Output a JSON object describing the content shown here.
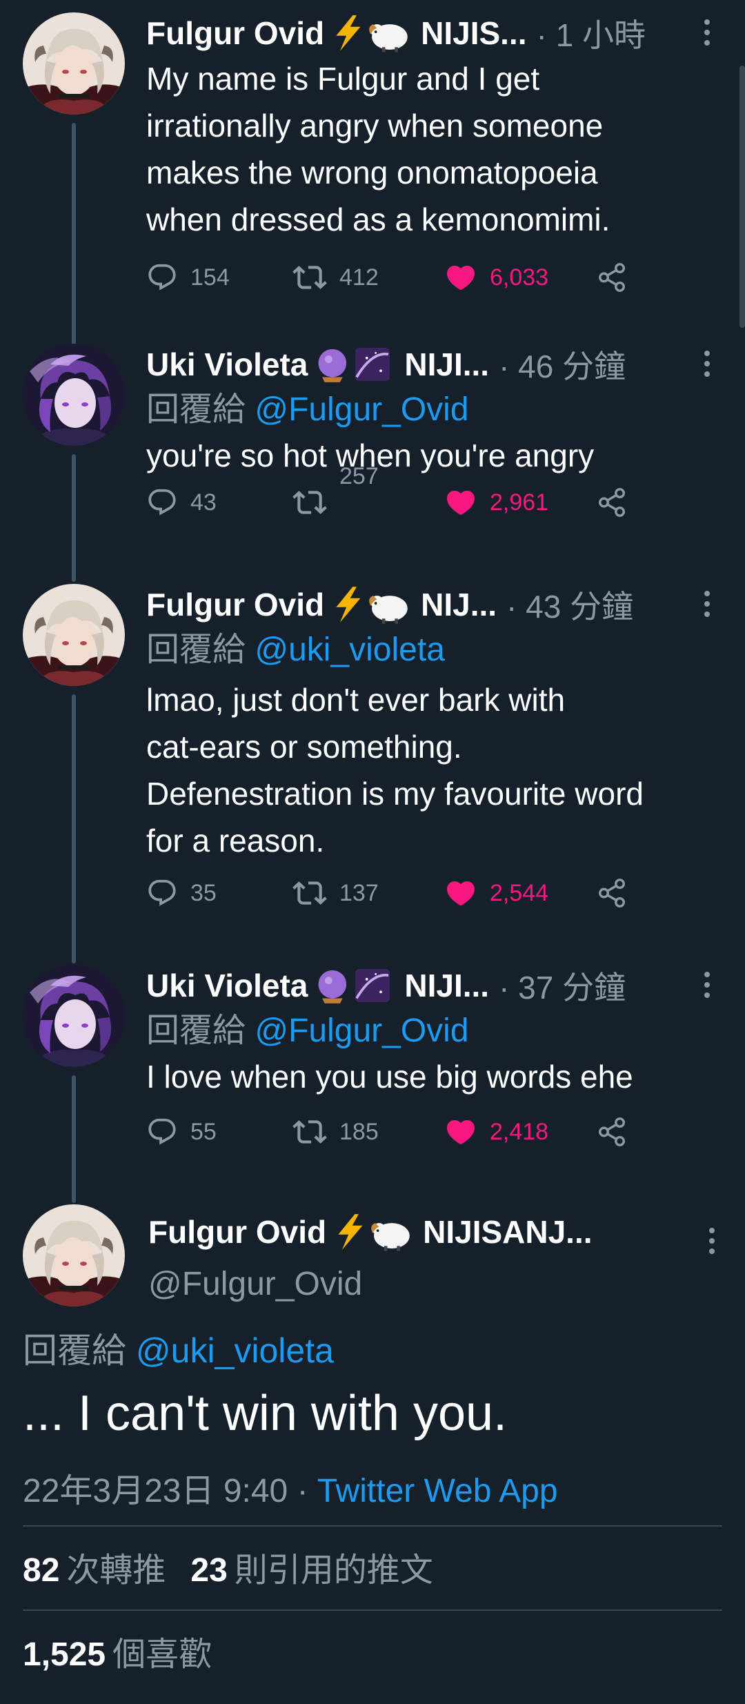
{
  "tweets": [
    {
      "name": "Fulgur Ovid",
      "suffix": "NIJIS...",
      "time": "· 1 小時",
      "reply_prefix": "",
      "reply_handle": "",
      "text_lines": [
        "My name is Fulgur and I get",
        "irrationally angry when someone",
        "makes the wrong onomatopoeia",
        "when dressed as a kemonomimi."
      ],
      "replies": "154",
      "retweets": "412",
      "likes": "6,033"
    },
    {
      "name": "Uki Violeta",
      "suffix": "NIJI...",
      "time": "· 46 分鐘",
      "reply_prefix": "回覆給",
      "reply_handle": "@Fulgur_Ovid",
      "text_lines": [
        "you're so hot when you're angry"
      ],
      "replies": "43",
      "retweets": "257",
      "likes": "2,961"
    },
    {
      "name": "Fulgur Ovid",
      "suffix": "NIJ...",
      "time": "· 43 分鐘",
      "reply_prefix": "回覆給",
      "reply_handle": "@uki_violeta",
      "text_lines": [
        "lmao, just don't ever bark with",
        "cat-ears or something.",
        "Defenestration is my favourite word",
        "for a reason."
      ],
      "replies": "35",
      "retweets": "137",
      "likes": "2,544"
    },
    {
      "name": "Uki Violeta",
      "suffix": "NIJI...",
      "time": "· 37 分鐘",
      "reply_prefix": "回覆給",
      "reply_handle": "@Fulgur_Ovid",
      "text_lines": [
        "I love when you use big words ehe"
      ],
      "replies": "55",
      "retweets": "185",
      "likes": "2,418"
    }
  ],
  "main": {
    "name": "Fulgur Ovid",
    "suffix": "NIJISANJ...",
    "handle": "@Fulgur_Ovid",
    "reply_prefix": "回覆給",
    "reply_handle": "@uki_violeta",
    "text": "... I can't win with you.",
    "datetime": "22年3月23日 9:40 ·",
    "source": "Twitter Web App",
    "retweet_count": "82",
    "retweet_label": "次轉推",
    "quote_count": "23",
    "quote_label": "則引用的推文",
    "like_count": "1,525",
    "like_label": "個喜歡"
  },
  "colors": {
    "background": "#15202b",
    "secondary_text": "#8b98a5",
    "link": "#1d9bf0",
    "like": "#f91880",
    "divider": "#38444d"
  },
  "icons": {
    "reply": "reply-icon",
    "retweet": "retweet-icon",
    "like": "heart-icon",
    "share": "share-icon",
    "more": "more-icon",
    "fulgur_emoji": "lightning-ram-emoji",
    "uki_emoji": "crystal-ball-galaxy-emoji"
  }
}
